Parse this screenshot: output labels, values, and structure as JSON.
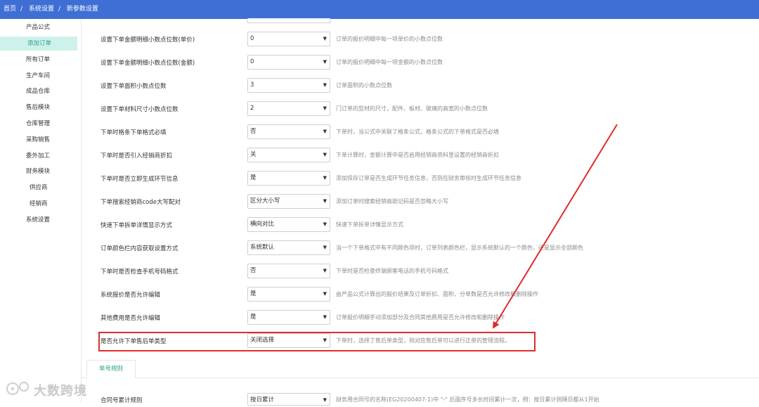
{
  "breadcrumb": [
    "首页",
    "系统设置",
    "新参数设置"
  ],
  "breadcrumb_sep": "/",
  "sidebar": {
    "items": [
      {
        "label": "产品公式",
        "indent": true,
        "active": false
      },
      {
        "label": "添加订单",
        "indent": true,
        "active": true
      },
      {
        "label": "所有订单",
        "indent": false,
        "active": false
      },
      {
        "label": "生产车间",
        "indent": false,
        "active": false
      },
      {
        "label": "成品仓库",
        "indent": false,
        "active": false
      },
      {
        "label": "售后模块",
        "indent": false,
        "active": false
      },
      {
        "label": "仓库管理",
        "indent": false,
        "active": false
      },
      {
        "label": "采购销售",
        "indent": false,
        "active": false
      },
      {
        "label": "委外加工",
        "indent": false,
        "active": false
      },
      {
        "label": "财务模块",
        "indent": false,
        "active": false
      },
      {
        "label": "供应商",
        "indent": true,
        "active": false
      },
      {
        "label": "经销商",
        "indent": true,
        "active": false
      },
      {
        "label": "系统设置",
        "indent": false,
        "active": false
      }
    ]
  },
  "settings": [
    {
      "label": "设置下单金额明细小数点位数(单价)",
      "value": "0",
      "desc": "订单的报价明细中每一项单价的小数点位数"
    },
    {
      "label": "设置下单金额明细小数点位数(金额)",
      "value": "0",
      "desc": "订单的报价明细中每一项金额的小数点位数"
    },
    {
      "label": "设置下单面积小数点位数",
      "value": "3",
      "desc": "订单面积的小数点位数"
    },
    {
      "label": "设置下单材料尺寸小数点位数",
      "value": "2",
      "desc": "门订单的型材的尺寸，配件、板材、玻璃的高宽的小数点位数"
    },
    {
      "label": "下单时格条下单格式必填",
      "value": "否",
      "desc": "下单时，当公式中关联了格条公式，格条公式的下单格式是否必填"
    },
    {
      "label": "下单时是否引入经销商折扣",
      "value": "关",
      "desc": "下单计算时，金额计算中是否启用经销商资料里设置的经销商折扣"
    },
    {
      "label": "下单时是否立即生成环节信息",
      "value": "是",
      "desc": "添加保存订单是否生成环节任务信息，否则在财务审核时生成环节任务信息"
    },
    {
      "label": "下单搜索经销商code大写配对",
      "value": "区分大小写",
      "desc": "添加订单时搜索经销商助记码是否忽略大小写"
    },
    {
      "label": "快速下单拆单详情显示方式",
      "value": "横向对比",
      "desc": "快速下单拆单详情显示方式"
    },
    {
      "label": "订单颜色栏内容获取设置方式",
      "value": "系统默认",
      "desc": "当一个下单格式中有不同颜色项时，订单列表颜色栏，显示系统默认的一个颜色，还是显示全部颜色"
    },
    {
      "label": "下单时是否检查手机号码格式",
      "value": "否",
      "desc": "下单时是否检查终端顾客电话的手机号码格式"
    },
    {
      "label": "系统报价是否允许编辑",
      "value": "是",
      "desc": "由产品公式计算出的报价结果及订单折扣、面积、分单数是否允许修改和删除操作"
    },
    {
      "label": "其他费用是否允许编辑",
      "value": "是",
      "desc": "订单报价明细手动添加部分及合同其他费用是否允许修改和删除操作"
    },
    {
      "label": "是否允许下单售后单类型",
      "value": "关闭选择",
      "desc": "下单时，选择了售后单类型，则对应售后单可以进行正单的管理流程。"
    }
  ],
  "tab": {
    "label": "单号规则"
  },
  "bottom_row": {
    "label": "合同号累计规则",
    "value": "按日累计",
    "desc": "财务用合同号的名称(EG20200407-1)中 \"-\" 后面序号多长时间累计一次，例：按日累计则隔日都从1开始"
  },
  "watermark": {
    "text": "大数跨境"
  },
  "colors": {
    "topbar": "#3f6fd4",
    "active_bg": "#cff1eb",
    "active_text": "#2b9f8e",
    "highlight": "#e02b2b"
  }
}
